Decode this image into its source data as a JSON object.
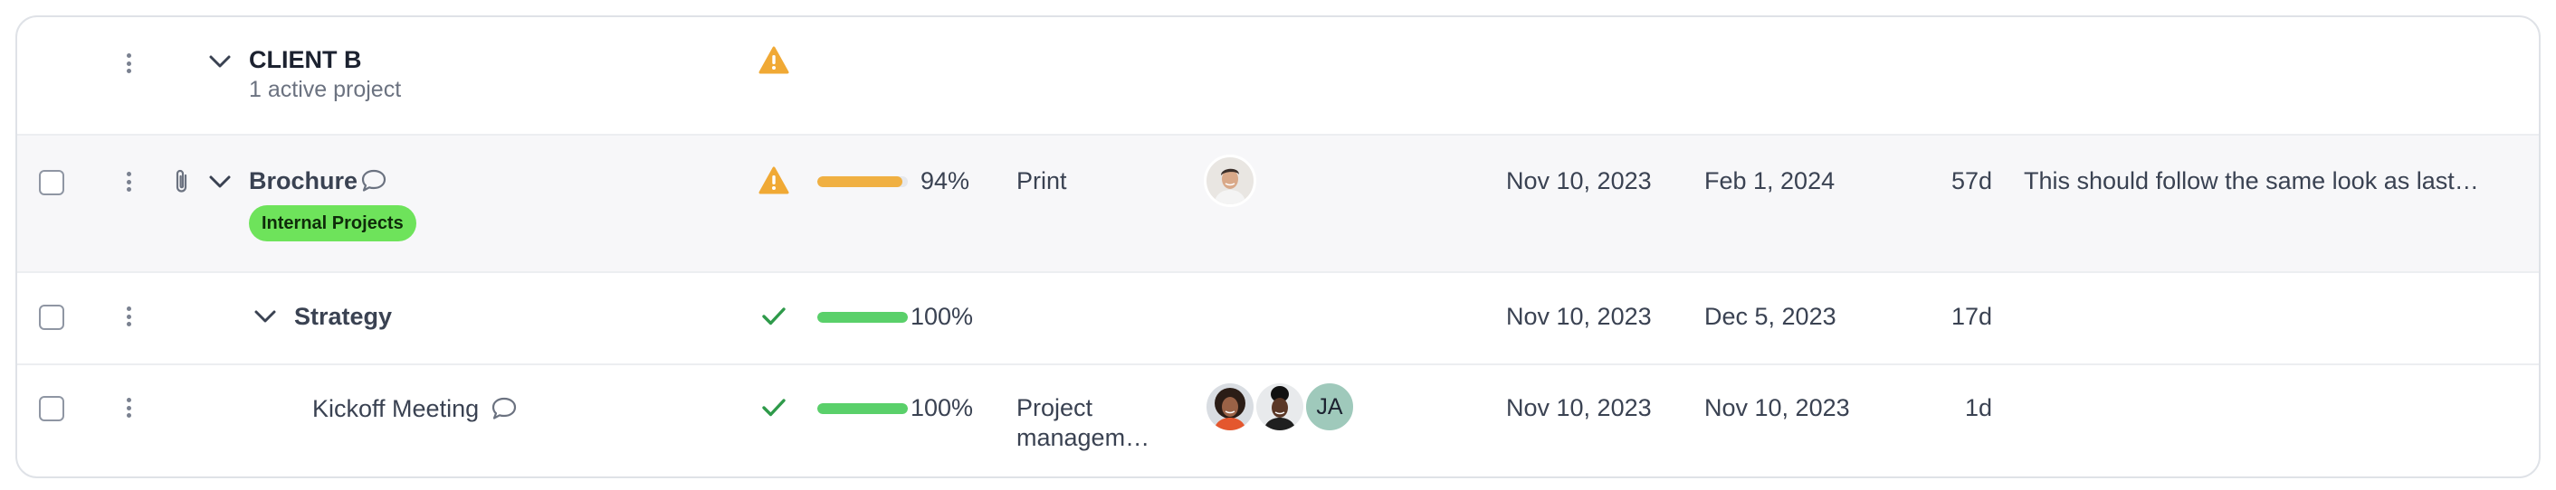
{
  "group": {
    "name": "CLIENT B",
    "subtitle": "1 active project"
  },
  "colors": {
    "warning": "#f0a935",
    "complete": "#2e9a4a",
    "progress_warning": "#f0b042",
    "progress_complete": "#5ad06a",
    "badge": "#6ee35b"
  },
  "rows": [
    {
      "name": "Brochure",
      "tag": "Internal Projects",
      "status_icon": "warning-icon",
      "progress_pct": 94,
      "progress_label": "94%",
      "category": "Print",
      "assignees": [
        "man-avatar"
      ],
      "start": "Nov 10, 2023",
      "end": "Feb 1, 2024",
      "duration": "57d",
      "notes": "This should follow the same look as last…",
      "has_comment": true,
      "has_attachment": true
    },
    {
      "name": "Strategy",
      "status_icon": "check-icon",
      "progress_pct": 100,
      "progress_label": "100%",
      "start": "Nov 10, 2023",
      "end": "Dec 5, 2023",
      "duration": "17d"
    },
    {
      "name": "Kickoff Meeting",
      "status_icon": "check-icon",
      "progress_pct": 100,
      "progress_label": "100%",
      "category_line1": "Project",
      "category_line2": "managem…",
      "assignees": [
        "woman-avatar-1",
        "woman-avatar-2",
        "JA"
      ],
      "start": "Nov 10, 2023",
      "end": "Nov 10, 2023",
      "duration": "1d",
      "has_comment": true
    }
  ]
}
